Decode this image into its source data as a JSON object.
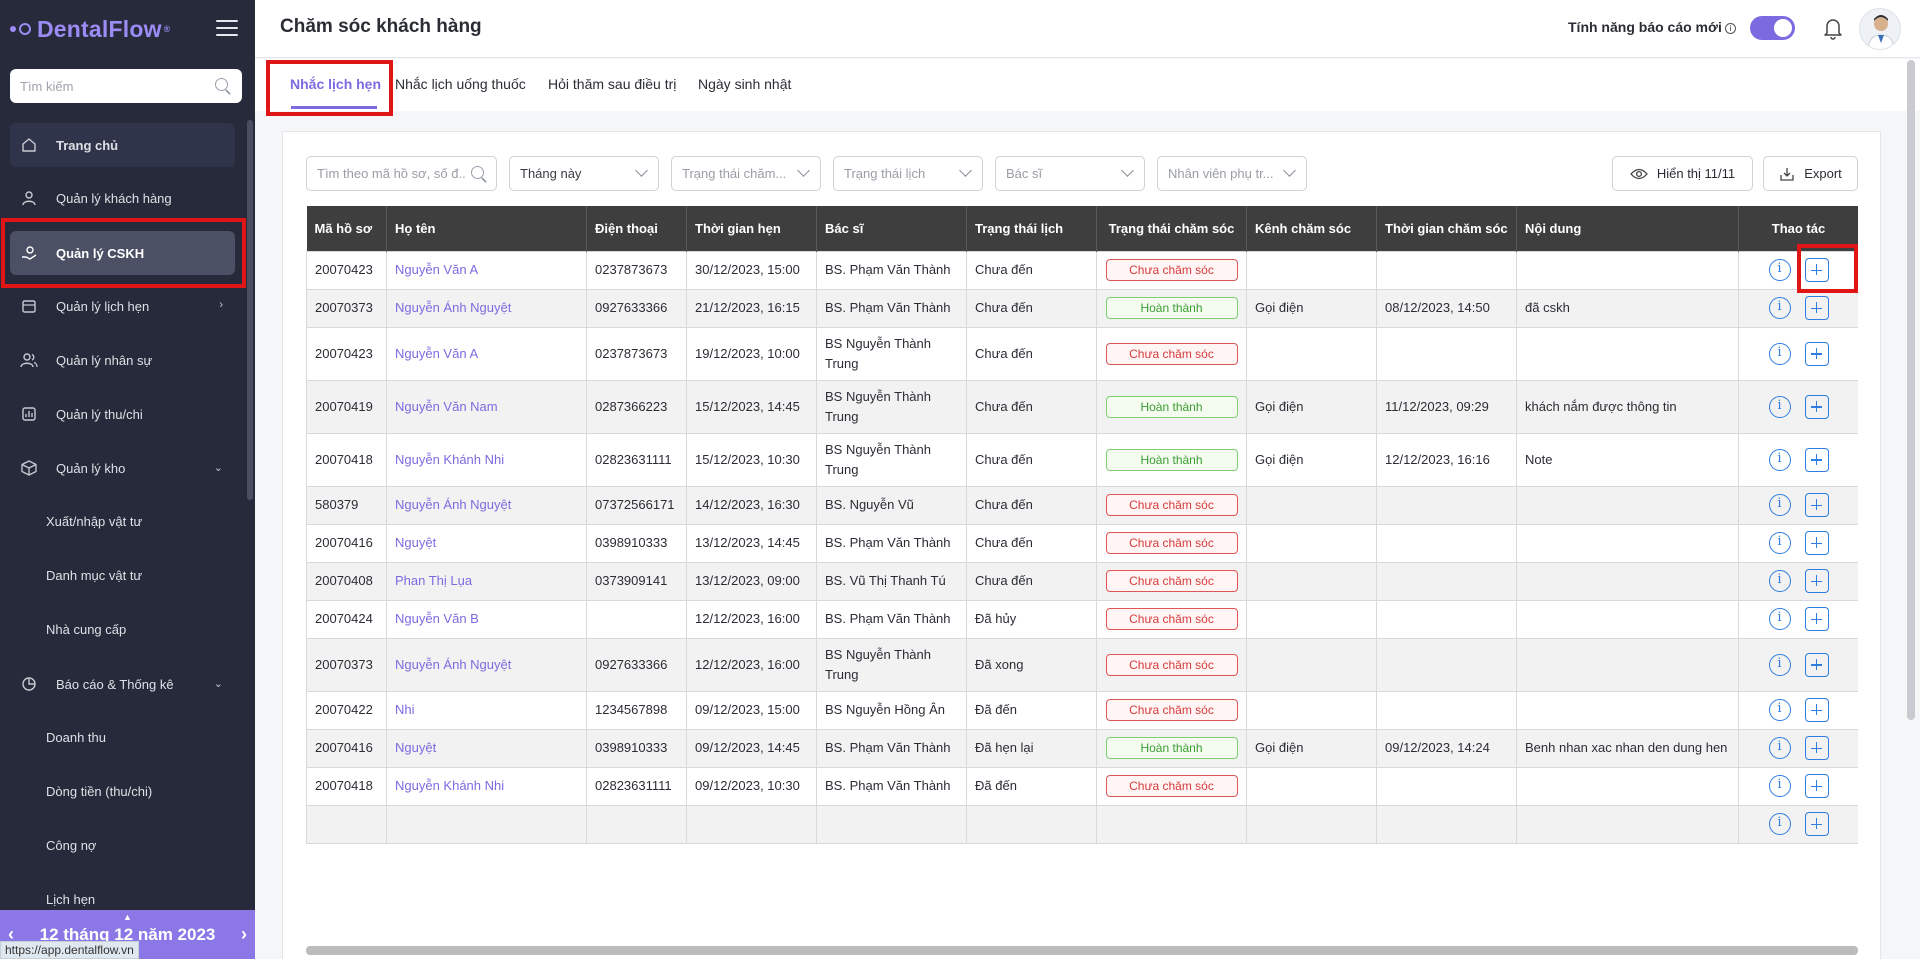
{
  "sidebar": {
    "logo": "DentalFlow",
    "logo_mark": "®",
    "search_placeholder": "Tìm kiếm",
    "items": [
      {
        "label": "Trang chủ",
        "icon": "home-icon"
      },
      {
        "label": "Quản lý khách hàng",
        "icon": "user-icon"
      },
      {
        "label": "Quản lý CSKH",
        "icon": "care-hand-icon"
      },
      {
        "label": "Quản lý lịch hẹn",
        "icon": "calendar-icon"
      },
      {
        "label": "Quản lý nhân sự",
        "icon": "users-icon"
      },
      {
        "label": "Quản lý thu/chi",
        "icon": "chart-icon"
      },
      {
        "label": "Quản lý kho",
        "icon": "box-icon"
      }
    ],
    "warehouse_sub": [
      "Xuất/nhập vật tư",
      "Danh mục vật tư",
      "Nhà cung cấp"
    ],
    "reports_label": "Báo cáo & Thống kê",
    "reports_sub": [
      "Doanh thu",
      "Dòng tiền (thu/chi)",
      "Công nợ",
      "Lịch hẹn"
    ],
    "date_label": "12 tháng 12 năm 2023",
    "status_url": "https://app.dentalflow.vn"
  },
  "header": {
    "title": "Chăm sóc khách hàng",
    "report_toggle_label": "Tính năng báo cáo mới"
  },
  "tabs": [
    "Nhắc lịch hẹn",
    "Nhắc lịch uống thuốc",
    "Hỏi thăm sau điều trị",
    "Ngày sinh nhật"
  ],
  "filters": {
    "search_placeholder": "Tìm theo mã hồ sơ, số đ...",
    "month": "Tháng này",
    "care_status": "Trạng thái chăm...",
    "appt_status": "Trạng thái lịch",
    "doctor": "Bác sĩ",
    "staff": "Nhân viên phụ tr...",
    "display_btn": "Hiển thị 11/11",
    "export_btn": "Export"
  },
  "table": {
    "columns": [
      "Mã hồ sơ",
      "Họ tên",
      "Điện thoại",
      "Thời gian hẹn",
      "Bác sĩ",
      "Trạng thái lịch",
      "Trạng thái chăm sóc",
      "Kênh chăm sóc",
      "Thời gian chăm sóc",
      "Nội dung",
      "Thao tác"
    ],
    "rows": [
      {
        "id": "20070423",
        "name": "Nguyễn Văn A",
        "phone": "0237873673",
        "time": "30/12/2023, 15:00",
        "doctor": "BS. Phạm Văn Thành",
        "appt": "Chưa đến",
        "care": "Chưa chăm sóc",
        "care_type": "red",
        "channel": "",
        "care_time": "",
        "content": ""
      },
      {
        "id": "20070373",
        "name": "Nguyễn Ánh Nguyệt",
        "phone": "0927633366",
        "time": "21/12/2023, 16:15",
        "doctor": "BS. Phạm Văn Thành",
        "appt": "Chưa đến",
        "care": "Hoàn thành",
        "care_type": "green",
        "channel": "Gọi điện",
        "care_time": "08/12/2023, 14:50",
        "content": "đã cskh"
      },
      {
        "id": "20070423",
        "name": "Nguyễn Văn A",
        "phone": "0237873673",
        "time": "19/12/2023, 10:00",
        "doctor": "BS Nguyễn Thành Trung",
        "appt": "Chưa đến",
        "care": "Chưa chăm sóc",
        "care_type": "red",
        "channel": "",
        "care_time": "",
        "content": ""
      },
      {
        "id": "20070419",
        "name": "Nguyễn Văn Nam",
        "phone": "0287366223",
        "time": "15/12/2023, 14:45",
        "doctor": "BS Nguyễn Thành Trung",
        "appt": "Chưa đến",
        "care": "Hoàn thành",
        "care_type": "green",
        "channel": "Gọi điện",
        "care_time": "11/12/2023, 09:29",
        "content": "khách nắm được thông tin"
      },
      {
        "id": "20070418",
        "name": "Nguyễn Khánh Nhi",
        "phone": "02823631111",
        "time": "15/12/2023, 10:30",
        "doctor": "BS Nguyễn Thành Trung",
        "appt": "Chưa đến",
        "care": "Hoàn thành",
        "care_type": "green",
        "channel": "Gọi điện",
        "care_time": "12/12/2023, 16:16",
        "content": "Note"
      },
      {
        "id": "580379",
        "name": "Nguyễn Ánh Nguyệt",
        "phone": "07372566171",
        "time": "14/12/2023, 16:30",
        "doctor": "BS. Nguyễn Vũ",
        "appt": "Chưa đến",
        "care": "Chưa chăm sóc",
        "care_type": "red",
        "channel": "",
        "care_time": "",
        "content": ""
      },
      {
        "id": "20070416",
        "name": "Nguyệt",
        "phone": "0398910333",
        "time": "13/12/2023, 14:45",
        "doctor": "BS. Phạm Văn Thành",
        "appt": "Chưa đến",
        "care": "Chưa chăm sóc",
        "care_type": "red",
        "channel": "",
        "care_time": "",
        "content": ""
      },
      {
        "id": "20070408",
        "name": "Phan Thị Lụa",
        "phone": "0373909141",
        "time": "13/12/2023, 09:00",
        "doctor": "BS. Vũ Thị Thanh Tú",
        "appt": "Chưa đến",
        "care": "Chưa chăm sóc",
        "care_type": "red",
        "channel": "",
        "care_time": "",
        "content": ""
      },
      {
        "id": "20070424",
        "name": "Nguyễn Văn B",
        "phone": "",
        "time": "12/12/2023, 16:00",
        "doctor": "BS. Phạm Văn Thành",
        "appt": "Đã hủy",
        "care": "Chưa chăm sóc",
        "care_type": "red",
        "channel": "",
        "care_time": "",
        "content": ""
      },
      {
        "id": "20070373",
        "name": "Nguyễn Ánh Nguyệt",
        "phone": "0927633366",
        "time": "12/12/2023, 16:00",
        "doctor": "BS Nguyễn Thành Trung",
        "appt": "Đã xong",
        "care": "Chưa chăm sóc",
        "care_type": "red",
        "channel": "",
        "care_time": "",
        "content": ""
      },
      {
        "id": "20070422",
        "name": "Nhi",
        "phone": "1234567898",
        "time": "09/12/2023, 15:00",
        "doctor": "BS Nguyễn Hồng Ân",
        "appt": "Đã đến",
        "care": "Chưa chăm sóc",
        "care_type": "red",
        "channel": "",
        "care_time": "",
        "content": ""
      },
      {
        "id": "20070416",
        "name": "Nguyệt",
        "phone": "0398910333",
        "time": "09/12/2023, 14:45",
        "doctor": "BS. Phạm Văn Thành",
        "appt": "Đã hẹn lại",
        "care": "Hoàn thành",
        "care_type": "green",
        "channel": "Gọi điện",
        "care_time": "09/12/2023, 14:24",
        "content": "Benh nhan xac nhan den dung hen"
      },
      {
        "id": "20070418",
        "name": "Nguyễn Khánh Nhi",
        "phone": "02823631111",
        "time": "09/12/2023, 10:30",
        "doctor": "BS. Phạm Văn Thành",
        "appt": "Đã đến",
        "care": "Chưa chăm sóc",
        "care_type": "red",
        "channel": "",
        "care_time": "",
        "content": ""
      },
      {
        "id": "",
        "name": "",
        "phone": "",
        "time": "",
        "doctor": "",
        "appt": "",
        "care": "",
        "care_type": "",
        "channel": "",
        "care_time": "",
        "content": ""
      }
    ]
  },
  "colors": {
    "accent": "#7c6be0",
    "sidebar_bg": "#262a3a",
    "header_row": "#3e3e3e",
    "status_red": "#d73b3b",
    "status_green": "#3d9c33",
    "action_blue": "#2f7de0",
    "highlight": "#e01515"
  }
}
